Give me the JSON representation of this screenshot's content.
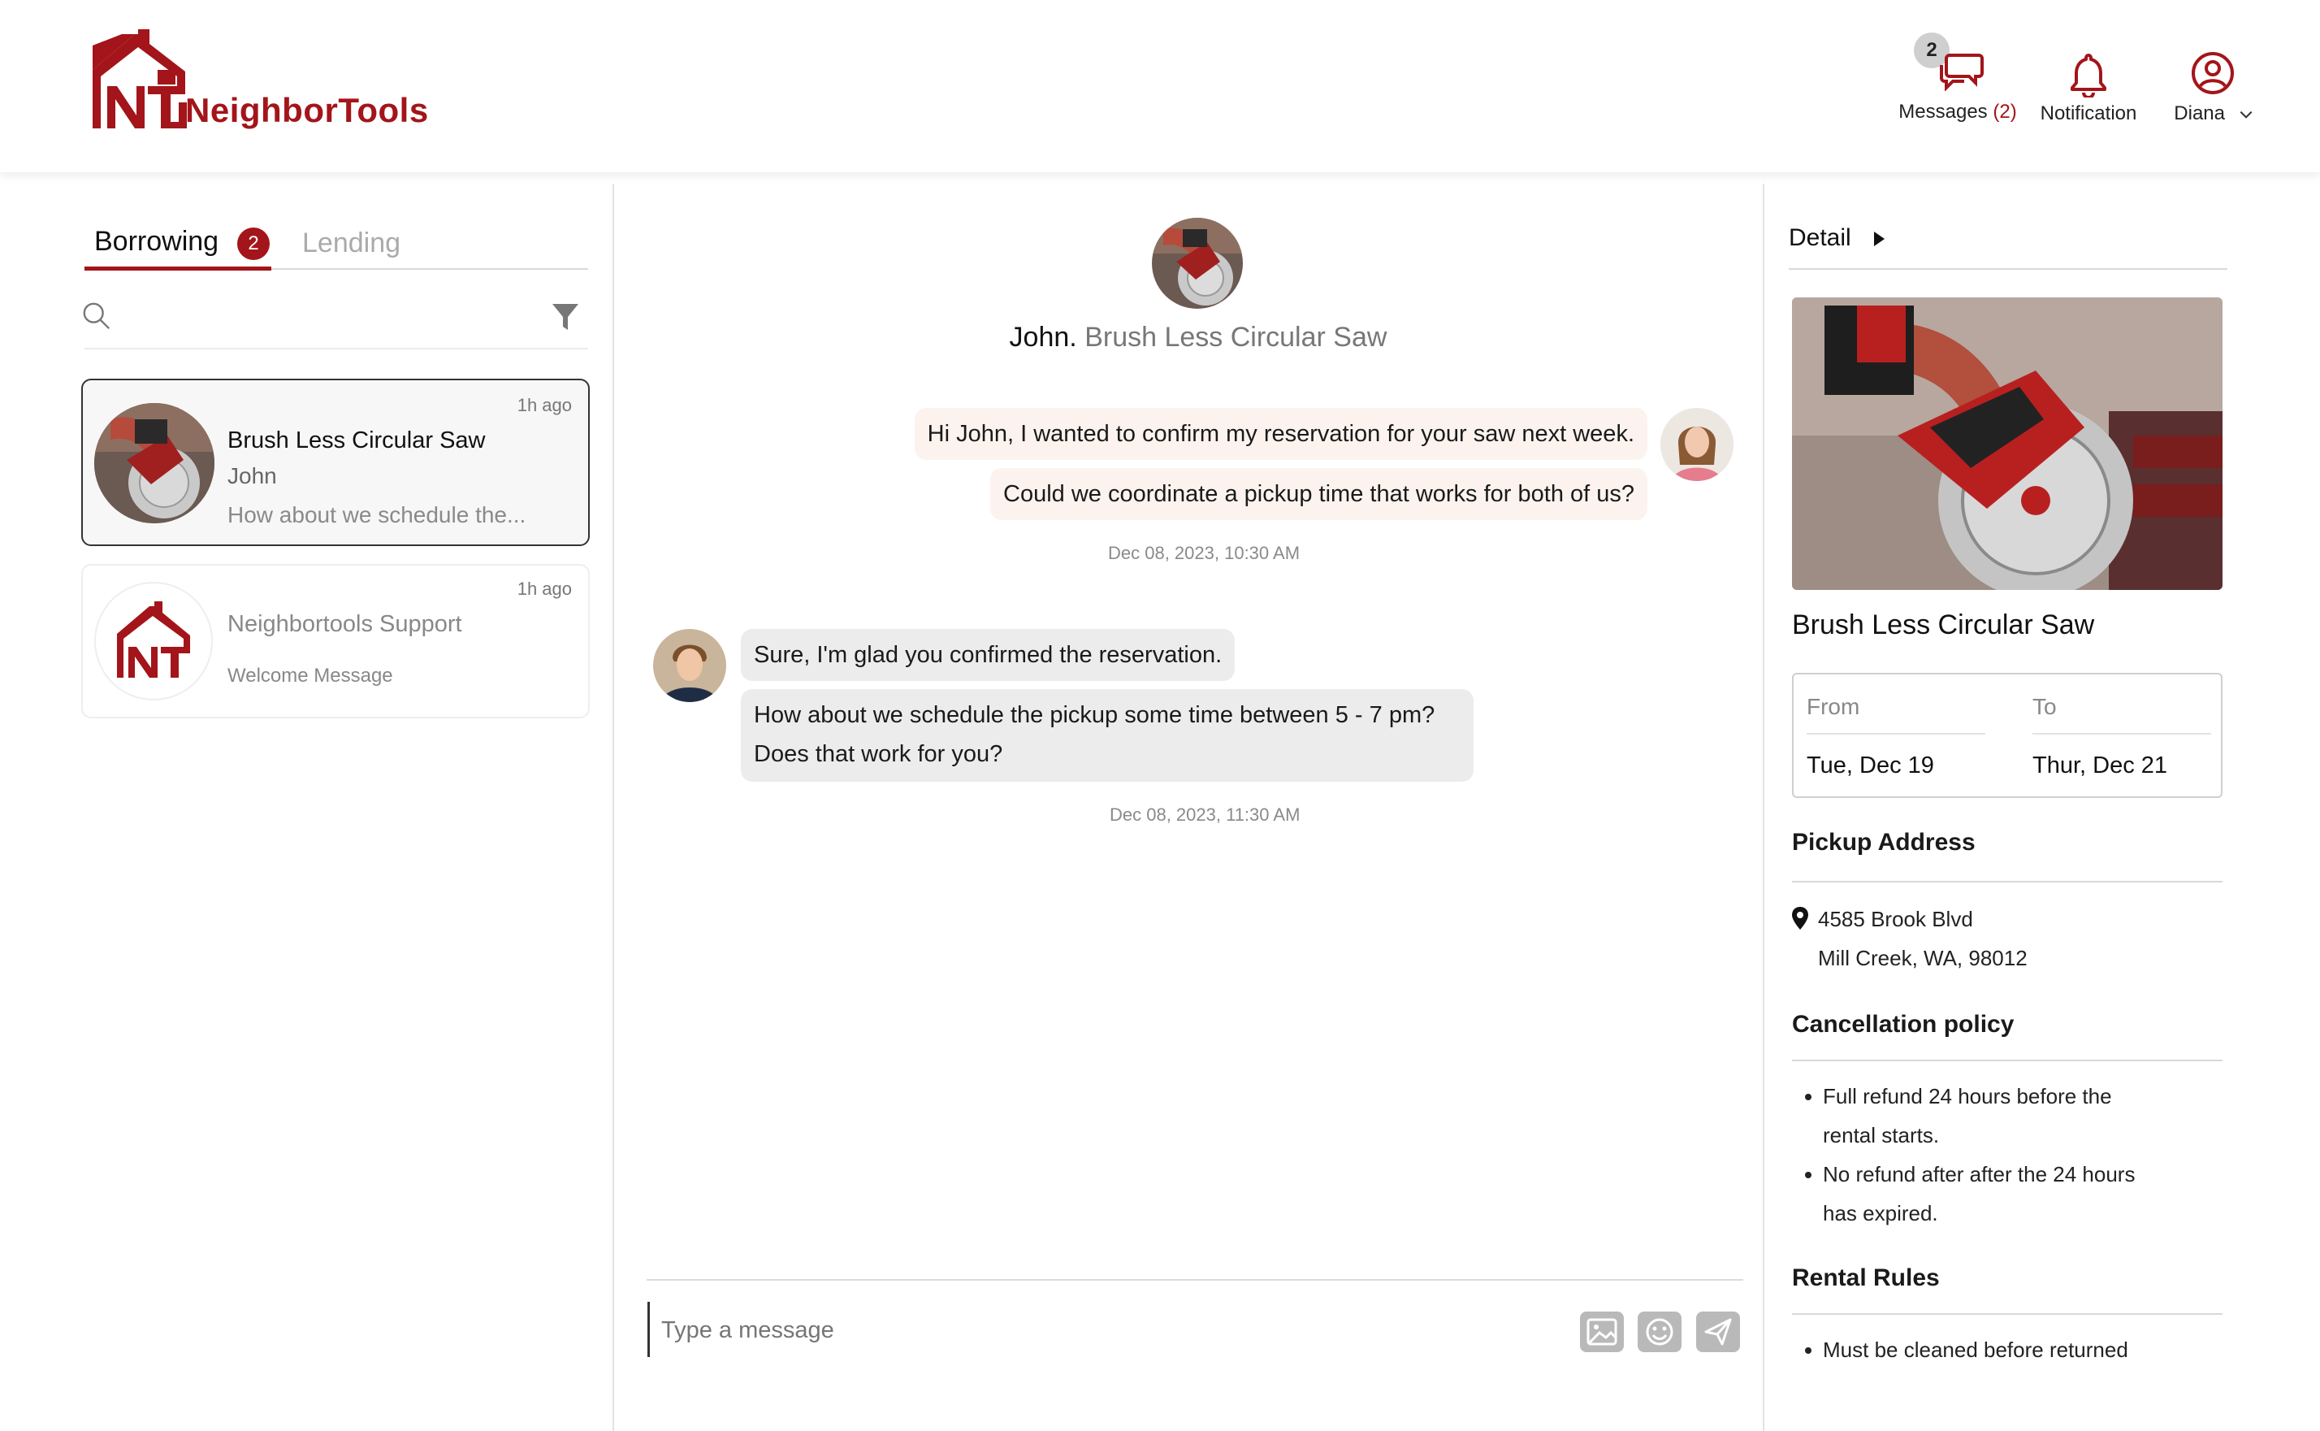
{
  "brand": {
    "name": "NeighborTools",
    "logo_letters": "NT",
    "color": "#a3151a"
  },
  "header": {
    "messages": {
      "label": "Messages",
      "count": "(2)",
      "badge": "2"
    },
    "notification": {
      "label": "Notification"
    },
    "user": {
      "name": "Diana"
    }
  },
  "left": {
    "tabs": [
      {
        "label": "Borrowing",
        "badge": "2"
      },
      {
        "label": "Lending"
      }
    ],
    "search": {
      "placeholder": ""
    },
    "conversations": [
      {
        "time": "1h ago",
        "title": "Brush Less Circular Saw",
        "name": "John",
        "preview": "How about we schedule the..."
      },
      {
        "time": "1h ago",
        "title": "Neighbortools Support",
        "preview": "Welcome Message"
      }
    ]
  },
  "chat": {
    "header_name": "John.",
    "header_item": "Brush Less Circular Saw",
    "outgoing": [
      "Hi John, I wanted to confirm my reservation for your saw next week.",
      "Could we coordinate a pickup time that works for both of us?"
    ],
    "outgoing_time": "Dec 08, 2023, 10:30 AM",
    "incoming": [
      "Sure, I'm glad you confirmed the reservation.",
      "How about we schedule the pickup some time between 5 - 7 pm?",
      "Does that work for you?"
    ],
    "incoming_time": "Dec 08, 2023, 11:30 AM",
    "input_placeholder": "Type a message"
  },
  "detail": {
    "heading": "Detail",
    "title": "Brush Less Circular Saw",
    "from_label": "From",
    "to_label": "To",
    "from_value": "Tue, Dec 19",
    "to_value": "Thur, Dec 21",
    "pickup_title": "Pickup Address",
    "address_line1": "4585 Brook Blvd",
    "address_line2": "Mill Creek, WA, 98012",
    "cancel_title": "Cancellation policy",
    "cancel_items": [
      [
        "Full refund 24 hours before the",
        "rental starts."
      ],
      [
        "No refund after after the 24 hours",
        "has expired."
      ]
    ],
    "rules_title": "Rental Rules",
    "rules_items": [
      "Must be cleaned before returned"
    ]
  }
}
